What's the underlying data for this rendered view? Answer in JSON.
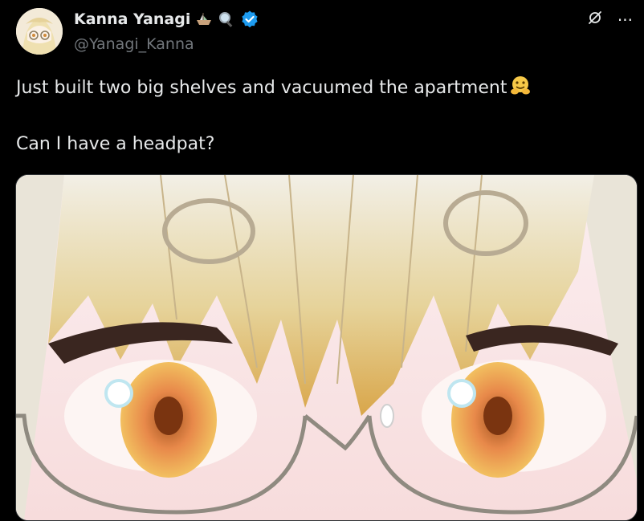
{
  "author": {
    "display_name": "Kanna Yanagi",
    "handle": "@Yanagi_Kanna",
    "badges": [
      "boat-emoji-icon",
      "magnifier-emoji-icon",
      "verified-badge-icon"
    ]
  },
  "actions": {
    "grok_icon": "grok-icon",
    "more_icon": "more-options-icon",
    "more_label": "···"
  },
  "tweet": {
    "line1": "Just built two big shelves and vacuumed the apartment",
    "line1_emoji": "hug-emoji",
    "line2": "Can I have a headpat?"
  },
  "media": {
    "kind": "anime character close-up eyes with glasses"
  },
  "colors": {
    "background": "#000000",
    "text": "#e7e9ea",
    "muted": "#71767b",
    "verified": "#1d9bf0"
  }
}
